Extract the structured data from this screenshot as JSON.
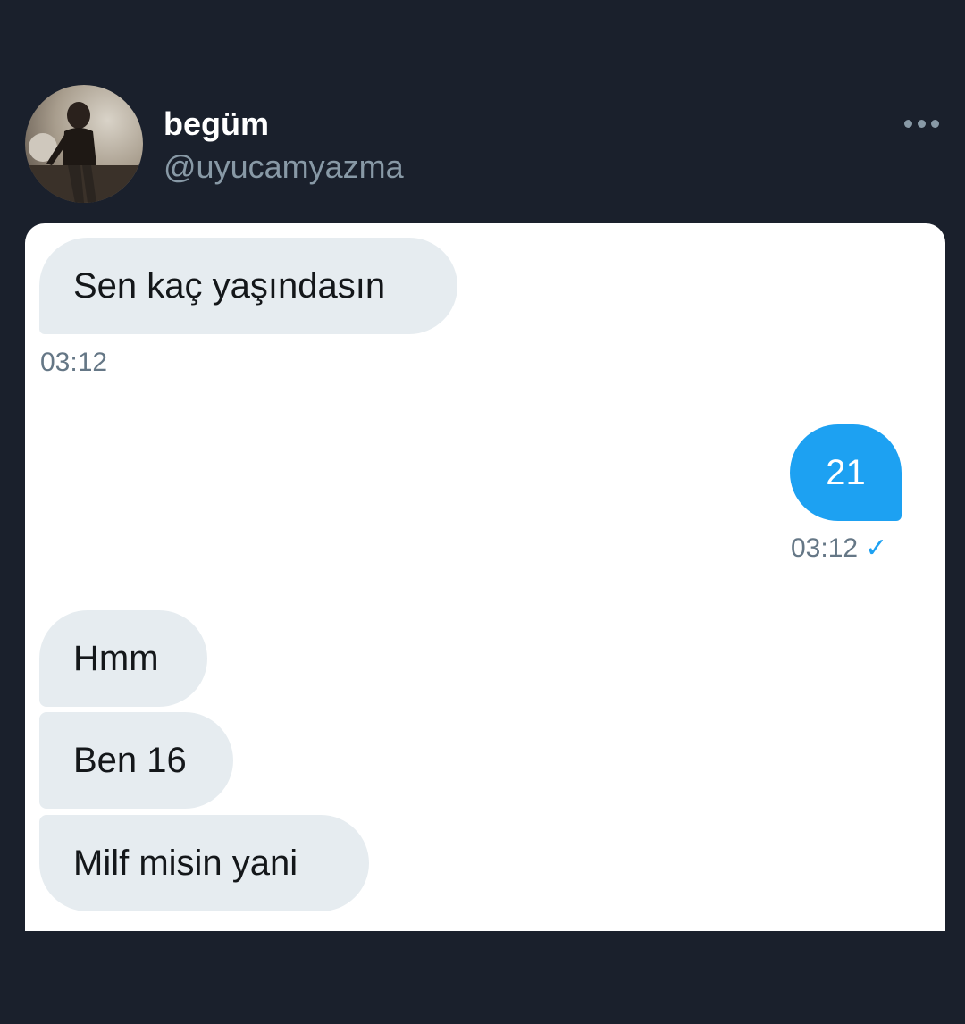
{
  "profile": {
    "display_name": "begüm",
    "handle": "@uyucamyazma",
    "more_icon": "more-horizontal-icon"
  },
  "conversation": {
    "messages": [
      {
        "direction": "received",
        "text": "Sen kaç yaşındasın"
      },
      {
        "direction": "sent",
        "text": "21"
      },
      {
        "direction": "received",
        "text": "Hmm"
      },
      {
        "direction": "received",
        "text": "Ben 16"
      },
      {
        "direction": "received",
        "text": "Milf misin yani"
      }
    ],
    "timestamps": {
      "first_received": "03:12",
      "sent": "03:12",
      "read_icon": "checkmark-icon",
      "read_mark": "✓"
    }
  },
  "colors": {
    "background": "#1a202c",
    "sent_bubble": "#1da1f2",
    "received_bubble": "#e6ecf0",
    "timestamp": "#657786"
  }
}
